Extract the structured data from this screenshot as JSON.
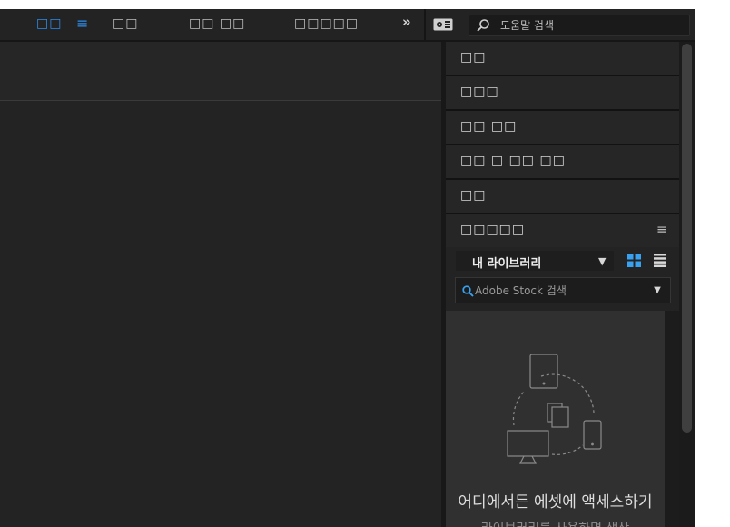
{
  "topbar": {
    "workspaces": [
      "□□",
      "□□",
      "□□ □□",
      "□□□□□"
    ],
    "active_workspace_index": 0,
    "menu_icon": "≡",
    "more_icon": "»",
    "help_search": {
      "placeholder": "도움말 검색",
      "icon": "search-icon"
    }
  },
  "panels": {
    "sections": [
      "□□",
      "□□□",
      "□□ □□",
      "□□ □ □□ □□",
      "□□",
      "□□□□□"
    ],
    "cc_libraries": {
      "menu_icon": "≡",
      "library_name": "내 라이브러리",
      "stock_search": {
        "placeholder": "Adobe Stock 검색"
      },
      "empty_state": {
        "title": "어디에서든 에셋에 액세스하기",
        "description": "라이브러리를 사용하면 생산"
      }
    }
  },
  "colors": {
    "accent": "#2d8ceb",
    "grid_view_icon": "#39a2f0",
    "background": "#1b1b1b",
    "panel": "#232323"
  }
}
